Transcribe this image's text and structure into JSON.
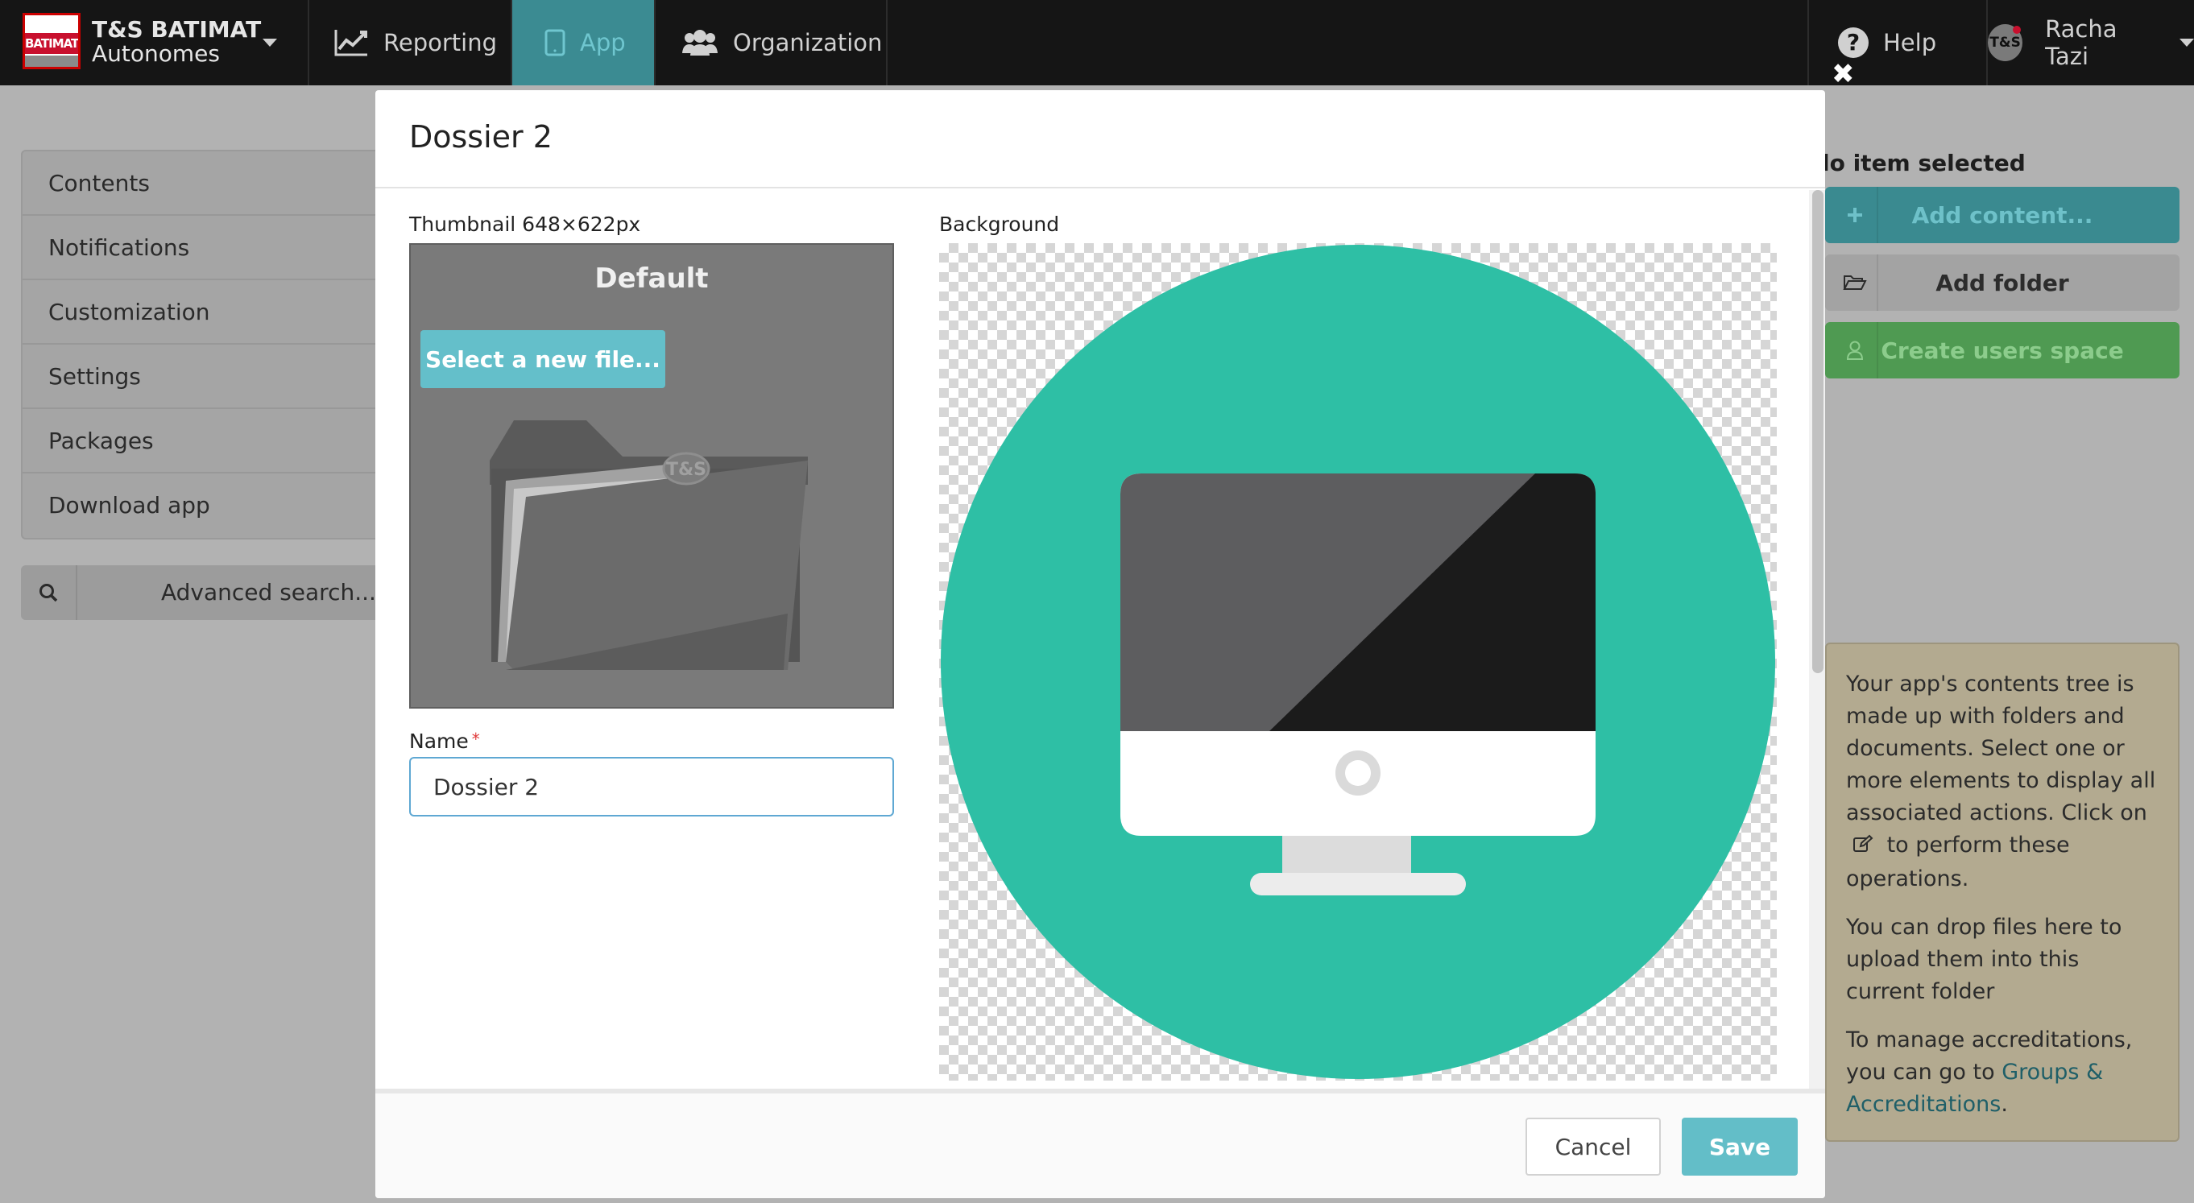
{
  "colors": {
    "topbar_bg": "#151515",
    "app_tab_bg": "#3b8b92",
    "accent_teal": "#63bec8",
    "preview_circle": "#2ebfa5",
    "add_content_bg": "#3a8a90",
    "create_users_bg": "#4f9a52",
    "info_box_bg": "#b3aa90",
    "required_mark": "#e03a3a"
  },
  "topbar": {
    "brand_logo_text": "BATIMAT",
    "brand_title": "T&S BATIMAT",
    "brand_subtitle": "Autonomes",
    "nav": [
      {
        "label": "Reporting",
        "icon": "chart-line-icon"
      },
      {
        "label": "App",
        "icon": "tablet-icon",
        "active": true
      },
      {
        "label": "Organization",
        "icon": "users-icon"
      }
    ],
    "help_label": "Help",
    "user_avatar_text": "T&S",
    "user_name": "Racha Tazi"
  },
  "close_glyph": "✖",
  "sidebar": {
    "items": [
      {
        "label": "Contents"
      },
      {
        "label": "Notifications"
      },
      {
        "label": "Customization"
      },
      {
        "label": "Settings"
      },
      {
        "label": "Packages"
      },
      {
        "label": "Download app"
      }
    ],
    "search_label": "Advanced search..."
  },
  "right_panel": {
    "selection_status": "lo item selected",
    "add_content_label": "Add content...",
    "add_folder_label": "Add folder",
    "create_users_label": "Create users space",
    "info": {
      "p1_before_icon": "Your app's contents tree is made up with folders and documents. Select one or more elements to display all associated actions. Click on",
      "p1_after_icon": "to perform these operations.",
      "p2": "You can drop files here to upload them into this current folder",
      "p3_prefix": "To manage accreditations, you can go to",
      "p3_link": "Groups & Accreditations",
      "p3_suffix": "."
    }
  },
  "modal": {
    "title": "Dossier 2",
    "thumbnail_label": "Thumbnail 648×622px",
    "thumbnail_default": "Default",
    "thumbnail_brand": "T&S",
    "select_file_label": "Select a new file...",
    "background_label": "Background",
    "name_label": "Name",
    "required_mark": "*",
    "name_value": "Dossier 2",
    "cancel_label": "Cancel",
    "save_label": "Save"
  }
}
